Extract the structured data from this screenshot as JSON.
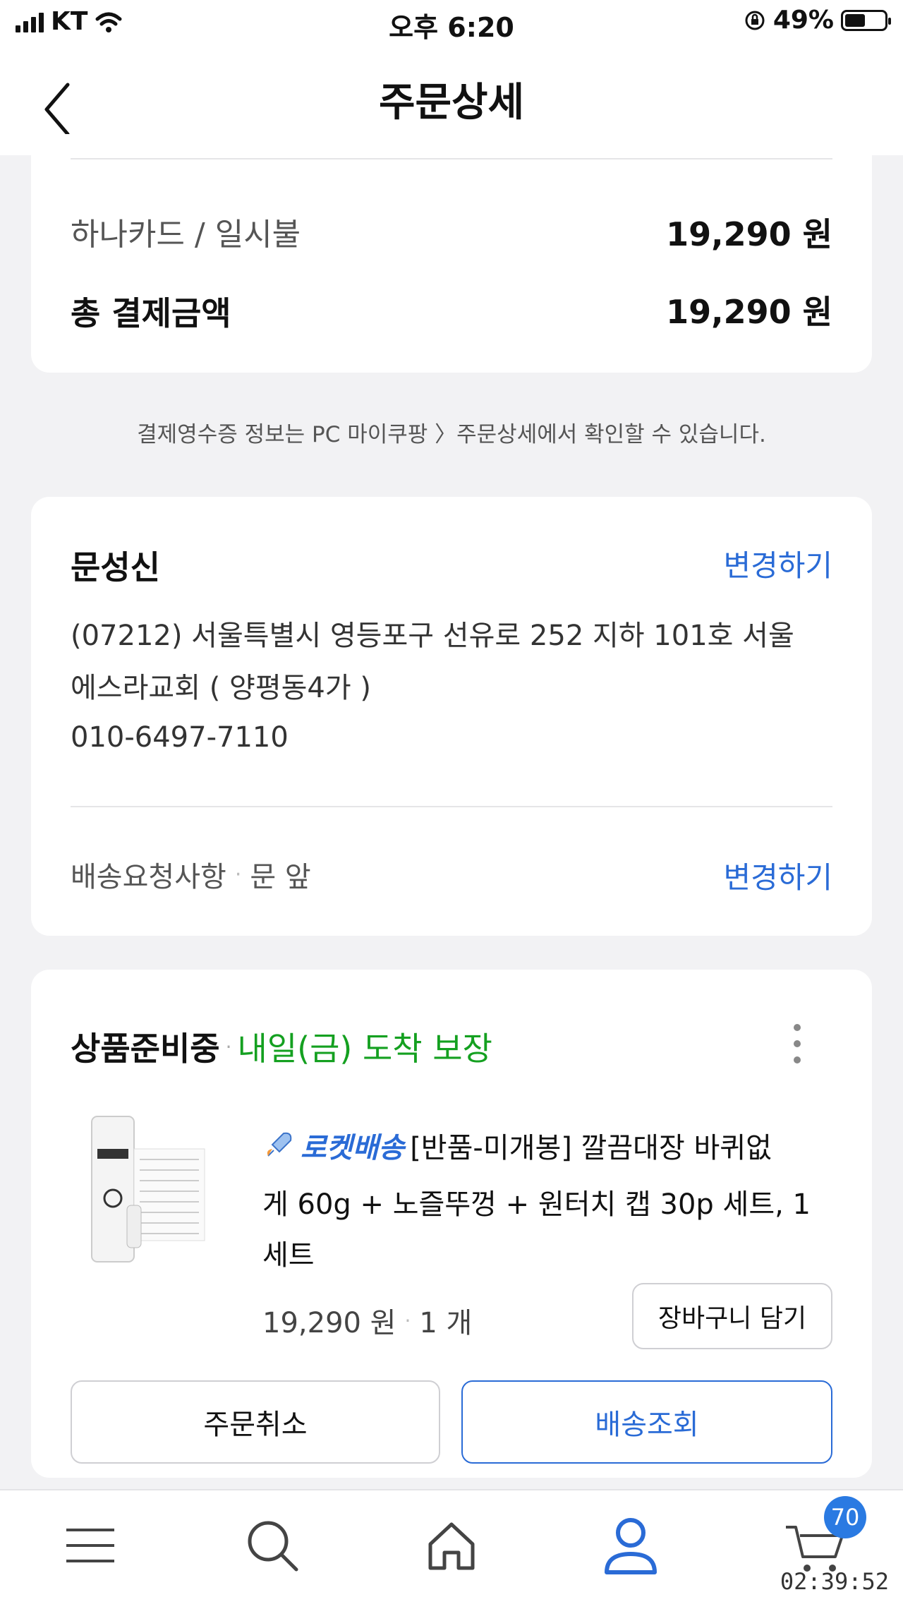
{
  "status_bar": {
    "carrier": "KT",
    "time": "오후 6:20",
    "battery": "49%"
  },
  "header": {
    "title": "주문상세"
  },
  "payment": {
    "method_label": "하나카드 / 일시불",
    "method_amount": "19,290 원",
    "total_label": "총 결제금액",
    "total_amount": "19,290 원"
  },
  "receipt_note": "결제영수증 정보는 PC 마이쿠팡 〉주문상세에서 확인할 수 있습니다.",
  "address": {
    "recipient": "문성신",
    "change_label": "변경하기",
    "line1": "(07212) 서울특별시 영등포구 선유로 252 지하 101호 서울",
    "line2": "에스라교회 ( 양평동4가 )",
    "phone": "010-6497-7110",
    "request_label": "배송요청사항",
    "request_value": "문 앞",
    "request_change_label": "변경하기"
  },
  "order": {
    "status": "상품준비중",
    "arrival": "내일(금) 도착 보장",
    "delivery_badge": "로켓배송",
    "product_line1": "[반품-미개봉] 깔끔대장 바퀴없",
    "product_line2": "게 60g + 노즐뚜껑 + 원터치 캡 30p 세트, 1",
    "product_line3": "세트",
    "price": "19,290 원",
    "quantity": "1 개",
    "cart_button": "장바구니 담기",
    "cancel_button": "주문취소",
    "track_button": "배송조회",
    "colors": {
      "arrival_green": "#14a020",
      "accent_blue": "#2a6bd6"
    }
  },
  "bottom_nav": {
    "items": [
      "menu-icon",
      "search-icon",
      "home-icon",
      "user-icon",
      "cart-icon"
    ],
    "cart_badge": "70",
    "timer": "02:39:52"
  }
}
